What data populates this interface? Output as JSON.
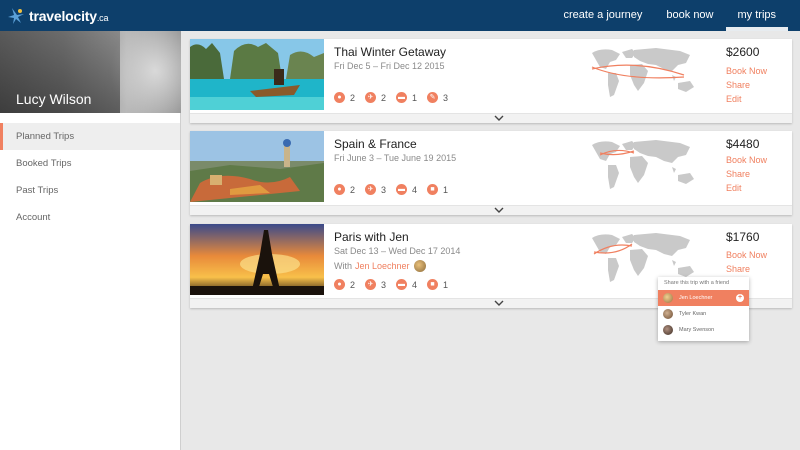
{
  "header": {
    "brand": "travelocity",
    "brand_suffix": ".ca",
    "nav": [
      {
        "label": "create a journey",
        "active": false
      },
      {
        "label": "book now",
        "active": false
      },
      {
        "label": "my trips",
        "active": true
      }
    ]
  },
  "sidebar": {
    "user_name": "Lucy Wilson",
    "items": [
      {
        "label": "Planned Trips",
        "active": true
      },
      {
        "label": "Booked Trips",
        "active": false
      },
      {
        "label": "Past Trips",
        "active": false
      },
      {
        "label": "Account",
        "active": false
      }
    ]
  },
  "trips": [
    {
      "title": "Thai Winter Getaway",
      "dates": "Fri Dec 5 – Fri Dec 12 2015",
      "stats": [
        {
          "icon": "person-icon",
          "value": "2"
        },
        {
          "icon": "plane-icon",
          "value": "2"
        },
        {
          "icon": "bed-icon",
          "value": "1"
        },
        {
          "icon": "activity-icon",
          "value": "3"
        }
      ],
      "price": "$2600",
      "actions": [
        "Book Now",
        "Share",
        "Edit"
      ]
    },
    {
      "title": "Spain & France",
      "dates": "Fri June 3 – Tue June 19 2015",
      "stats": [
        {
          "icon": "person-icon",
          "value": "2"
        },
        {
          "icon": "plane-icon",
          "value": "3"
        },
        {
          "icon": "bed-icon",
          "value": "4"
        },
        {
          "icon": "car-icon",
          "value": "1"
        }
      ],
      "price": "$4480",
      "actions": [
        "Book Now",
        "Share",
        "Edit"
      ]
    },
    {
      "title": "Paris with Jen",
      "dates": "Sat Dec 13 – Wed Dec 17 2014",
      "with_label": "With",
      "with_name": "Jen Loechner",
      "stats": [
        {
          "icon": "person-icon",
          "value": "2"
        },
        {
          "icon": "plane-icon",
          "value": "3"
        },
        {
          "icon": "bed-icon",
          "value": "4"
        },
        {
          "icon": "car-icon",
          "value": "1"
        }
      ],
      "price": "$1760",
      "actions": [
        "Book Now",
        "Share"
      ]
    }
  ],
  "share_popup": {
    "heading": "Share this trip with a friend",
    "friends": [
      {
        "name": "Jen Loechner",
        "selected": true
      },
      {
        "name": "Tyler Kwan",
        "selected": false
      },
      {
        "name": "Mary Svenson",
        "selected": false
      }
    ]
  },
  "colors": {
    "header_bg": "#0d3f6b",
    "accent": "#f08060",
    "page_bg": "#e8e8e8"
  }
}
